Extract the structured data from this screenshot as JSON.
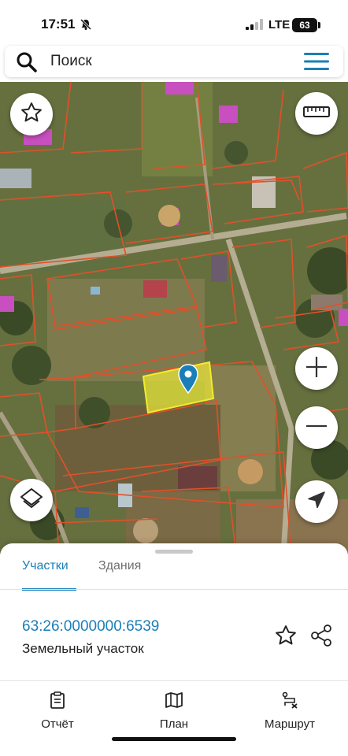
{
  "status_bar": {
    "time": "17:51",
    "network": "LTE",
    "battery": "63"
  },
  "search": {
    "placeholder": "Поиск"
  },
  "map": {
    "selected_plot_color": "#e7e33b",
    "boundary_color": "#e2502a",
    "pin_color": "#1a7fb8"
  },
  "sheet": {
    "tabs": [
      {
        "label": "Участки",
        "active": true
      },
      {
        "label": "Здания",
        "active": false
      }
    ],
    "parcel": {
      "cadastral_number": "63:26:0000000:6539",
      "type": "Земельный участок"
    }
  },
  "bottom_nav": [
    {
      "label": "Отчёт",
      "icon": "report-icon"
    },
    {
      "label": "План",
      "icon": "map-icon"
    },
    {
      "label": "Маршрут",
      "icon": "route-icon"
    }
  ],
  "colors": {
    "accent": "#1a7fb8",
    "text": "#222222"
  }
}
